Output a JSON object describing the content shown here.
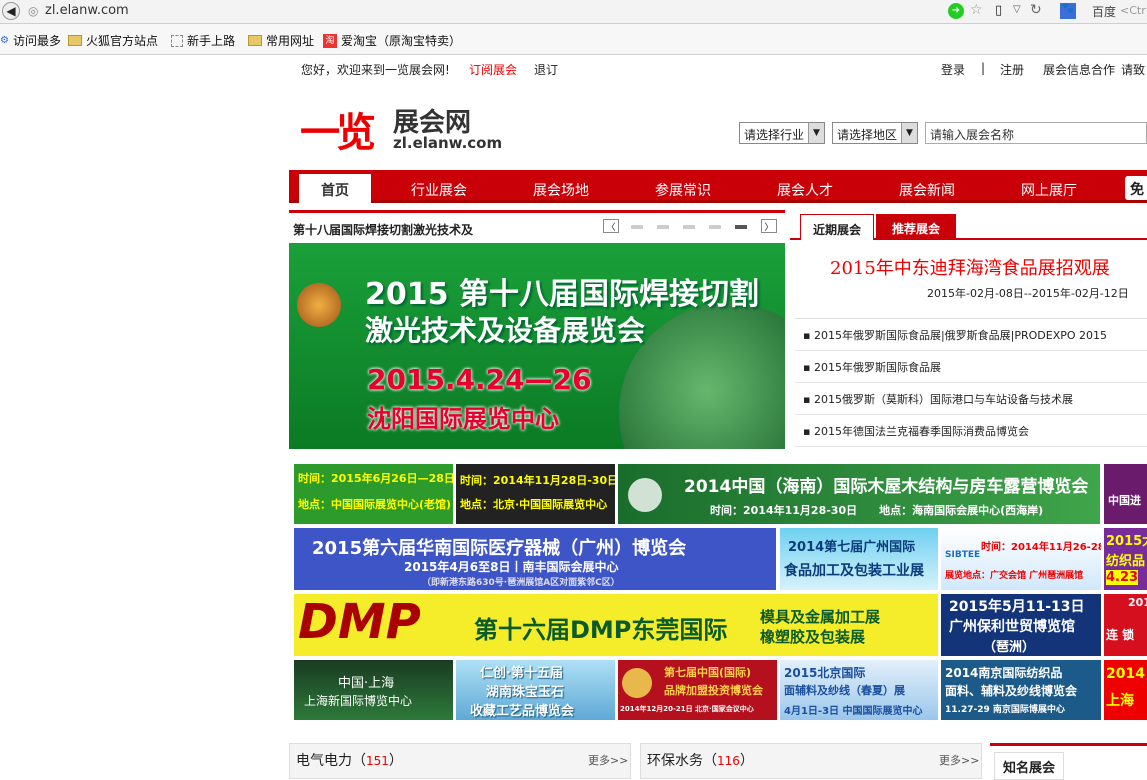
{
  "browser": {
    "url": "zl.elanw.com",
    "search_engine": "百度",
    "search_hint": "<Ctr"
  },
  "bookmarks": [
    "访问最多",
    "火狐官方站点",
    "新手上路",
    "常用网址",
    "爱淘宝（原淘宝特卖）"
  ],
  "topbar": {
    "welcome": "您好，欢迎来到一览展会网!",
    "subscribe": "订阅展会",
    "unsubscribe": "退订",
    "login": "登录",
    "sep": "|",
    "register": "注册",
    "coop": "展会信息合作",
    "contact": "请致"
  },
  "logo": {
    "cn_big": "一览",
    "cn_small": "展会网",
    "domain": "zl.elanw.com"
  },
  "search": {
    "industry": "请选择行业",
    "region": "请选择地区",
    "keyword_placeholder": "请输入展会名称"
  },
  "nav": [
    "首页",
    "行业展会",
    "展会场地",
    "参展常识",
    "展会人才",
    "展会新闻",
    "网上展厅"
  ],
  "nav_free": "免",
  "slider": {
    "caption": "第十八届国际焊接切割激光技术及",
    "title1": "2015 第十八届国际焊接切割",
    "title2": "激光技术及设备展览会",
    "date": "2015.4.24—26",
    "venue": "沈阳国际展览中心"
  },
  "tabs": {
    "recent": "近期展会",
    "recommend": "推荐展会"
  },
  "featured": {
    "title": "2015年中东迪拜海湾食品展招观展",
    "dates": "2015年-02月-08日--2015年-02月-12日"
  },
  "news": [
    "2015年俄罗斯国际食品展|俄罗斯食品展|PRODEXPO 2015",
    "2015年俄罗斯国际食品展",
    "2015俄罗斯（莫斯科）国际港口与车站设备与技术展",
    "2015年德国法兰克福春季国际消费品博览会"
  ],
  "ads": {
    "a1": "时间：2015年6月26日—28日",
    "a1b": "地点：中国国际展览中心(老馆)",
    "a2": "时间：2014年11月28日-30日",
    "a2b": "地点：北京·中国国际展览中心",
    "a3": "2014中国（海南）国际木屋木结构与房车露营博览会",
    "a3b": "时间：2014年11月28-30日　　地点：海南国际会展中心(西海岸)",
    "a4": "中国进",
    "b1": "2015第六届华南国际医疗器械（广州）博览会",
    "b1b": "2015年4月6至8日丨南丰国际会展中心",
    "b1c": "（即新港东路630号·琶洲展馆A区对面紫邻C区）",
    "b2": "2014第七届广州国际",
    "b2b": "食品加工及包装工业展",
    "b3": "时间：2014年11月26-28日",
    "b3b": "展览地点：广交会馆 广州琶洲展馆",
    "b3logo": "SIBTEE",
    "b4": "2015大",
    "b4b": "纺织品",
    "b4c": "4.23",
    "c1": "DMP",
    "c1b": "第十六届DMP东莞国际",
    "c1c": "模具及金属加工展",
    "c1d": "橡塑胶及包装展",
    "c2": "2015年5月11-13日",
    "c2b": "广州保利世贸博览馆",
    "c2c": "（琶洲）",
    "c3": "201",
    "c3b": "连 锁",
    "d1": "中国·上海",
    "d1b": "上海新国际博览中心",
    "d2": "仁创·第十五届",
    "d2b": "湖南珠宝玉石",
    "d2c": "收藏工艺品博览会",
    "d3": "第七届中国(国际)",
    "d3b": "品牌加盟投资博览会",
    "d3c": "2014年12月20-21日 北京·国家会议中心",
    "d4": "2015北京国际",
    "d4b": "面辅料及纱线（春夏）展",
    "d4c": "4月1日-3日 中国国际展览中心",
    "d5": "2014南京国际纺织品",
    "d5b": "面料、辅料及纱线博览会",
    "d5c": "11.27-29 南京国际博展中心",
    "d6": "2014",
    "d6b": "上海"
  },
  "sections": [
    {
      "title": "电气电力",
      "count": "151",
      "more": "更多>>"
    },
    {
      "title": "环保水务",
      "count": "116",
      "more": "更多>>"
    }
  ],
  "famous": "知名展会"
}
